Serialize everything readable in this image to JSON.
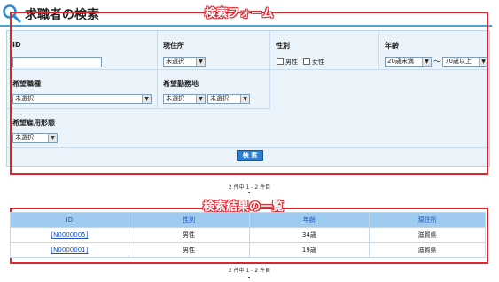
{
  "page": {
    "title": "求職者の検索"
  },
  "annotations": {
    "form_label": "検索フォーム",
    "results_label": "検索結果の一覧"
  },
  "form": {
    "id_label": "ID",
    "location_label": "現住所",
    "location_value": "未選択",
    "gender_label": "性別",
    "gender_options": [
      "男性",
      "女性"
    ],
    "age_label": "年齢",
    "age_from": "20歳未満",
    "age_to": "70歳以上",
    "tilde": "～",
    "job_label": "希望職種",
    "job_value": "未選択",
    "work_area_label": "希望勤務地",
    "work_area_values": [
      "未選択",
      "未選択"
    ],
    "employment_label": "希望雇用形態",
    "employment_value": "未選択",
    "search_button": "検 索"
  },
  "pagination": {
    "text": "2 件中 1 ‐ 2 件目"
  },
  "results": {
    "headers": [
      "ID",
      "性別",
      "年齢",
      "現住所"
    ],
    "rows": [
      {
        "id": "[N0000005]",
        "gender": "男性",
        "age": "34歳",
        "address": "滋賀県"
      },
      {
        "id": "[N0000001]",
        "gender": "男性",
        "age": "19歳",
        "address": "滋賀県"
      }
    ]
  },
  "colors": {
    "accent_red": "#e0242e",
    "header_blue": "#9ecbef",
    "link_blue": "#1a56c8"
  }
}
